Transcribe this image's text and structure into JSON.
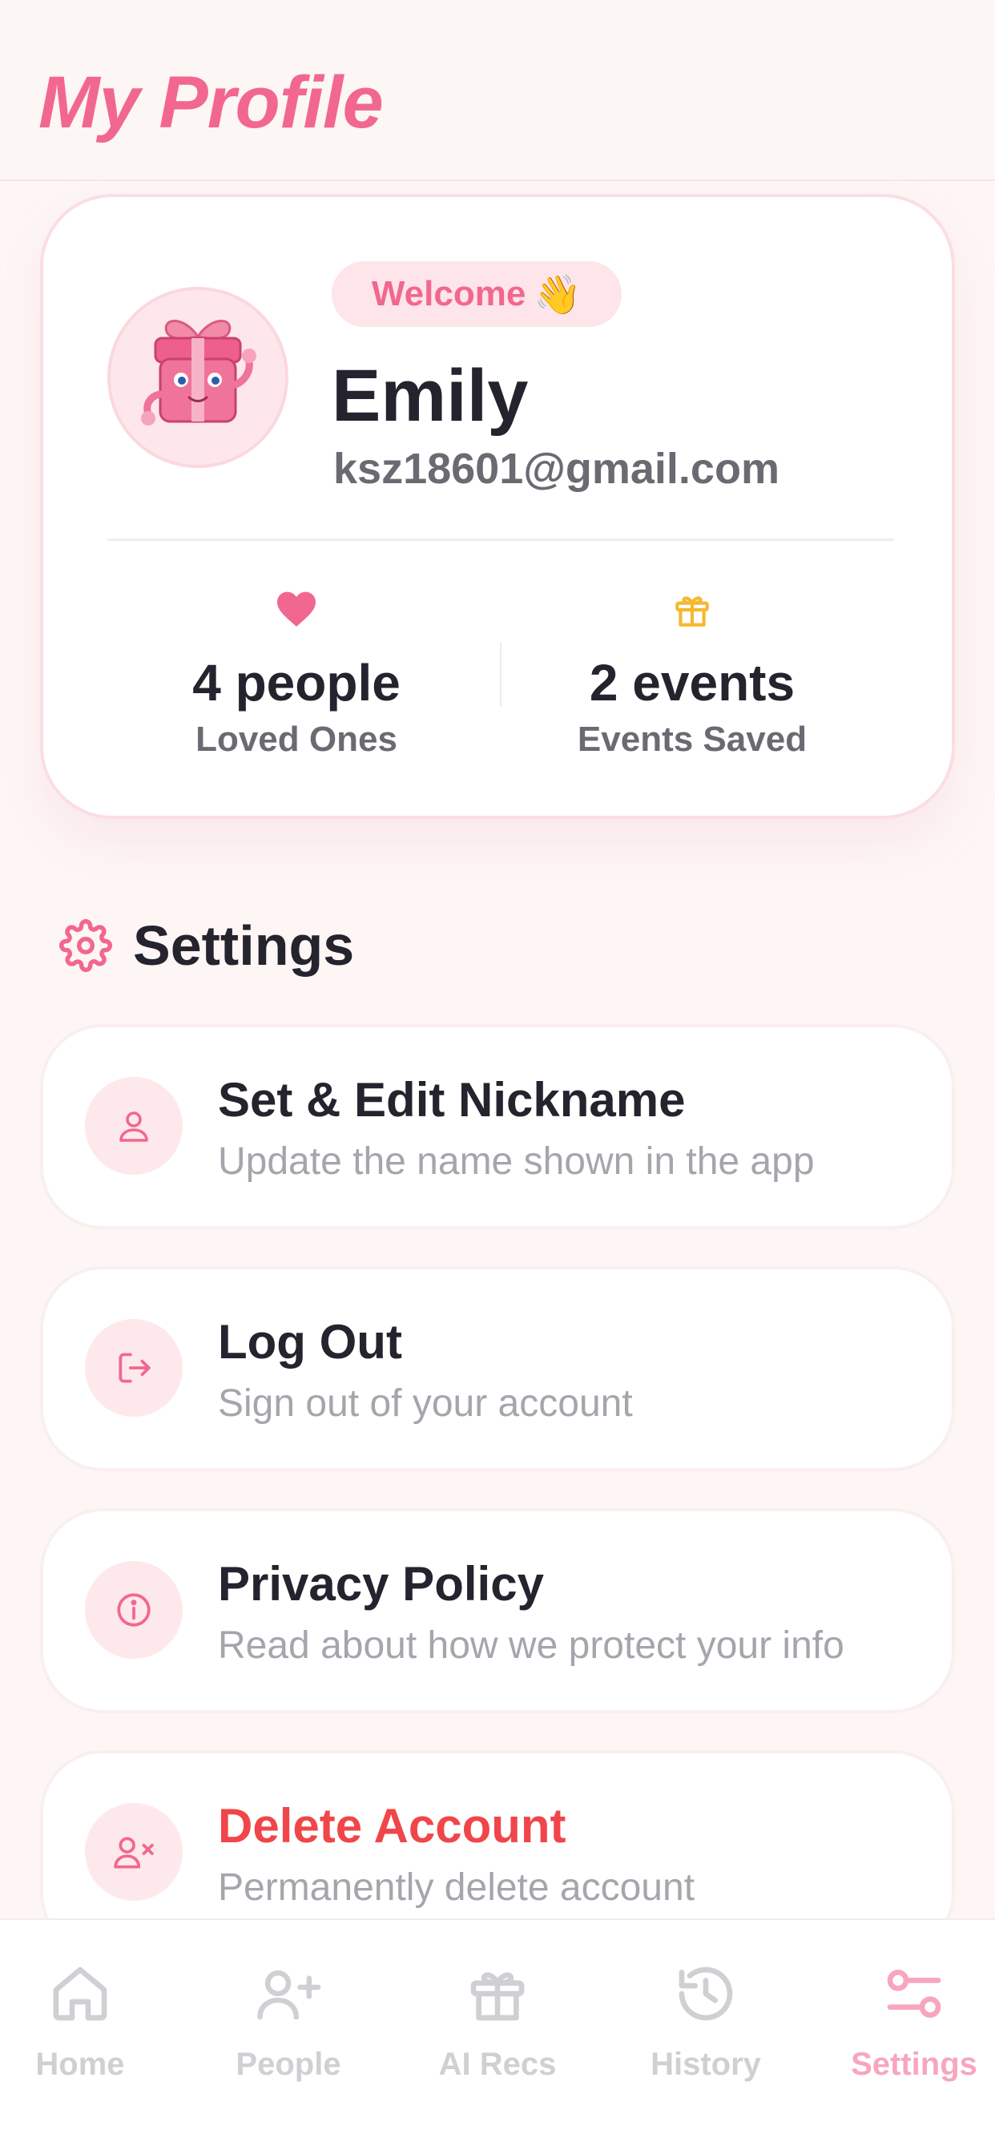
{
  "header": {
    "title": "My Profile"
  },
  "profile": {
    "welcome_label": "Welcome",
    "welcome_emoji": "👋",
    "name": "Emily",
    "email": "ksz18601@gmail.com",
    "avatar_icon": "gift-box-mascot-icon",
    "stats": [
      {
        "icon": "heart-icon",
        "value": "4 people",
        "label": "Loved Ones"
      },
      {
        "icon": "gift-icon",
        "value": "2 events",
        "label": "Events Saved"
      }
    ]
  },
  "settings": {
    "title": "Settings",
    "icon": "gear-icon",
    "items": [
      {
        "icon": "user-icon",
        "title": "Set & Edit Nickname",
        "subtitle": "Update the name shown in the app"
      },
      {
        "icon": "logout-icon",
        "title": "Log Out",
        "subtitle": "Sign out of your account"
      },
      {
        "icon": "info-icon",
        "title": "Privacy Policy",
        "subtitle": "Read about how we protect your info"
      },
      {
        "icon": "user-remove-icon",
        "title": "Delete Account",
        "subtitle": "Permanently delete account"
      }
    ]
  },
  "nav": {
    "active": "Settings",
    "items": [
      {
        "label": "Home",
        "icon": "home-icon"
      },
      {
        "label": "People",
        "icon": "user-plus-icon"
      },
      {
        "label": "AI Recs",
        "icon": "gift-icon"
      },
      {
        "label": "History",
        "icon": "history-icon"
      },
      {
        "label": "Settings",
        "icon": "sliders-icon"
      }
    ]
  },
  "colors": {
    "accent_pink": "#f2678f",
    "danger_red": "#f0464a",
    "gold": "#f5b92f",
    "nav_inactive": "#d0cfd3",
    "nav_active": "#f7a6be"
  }
}
